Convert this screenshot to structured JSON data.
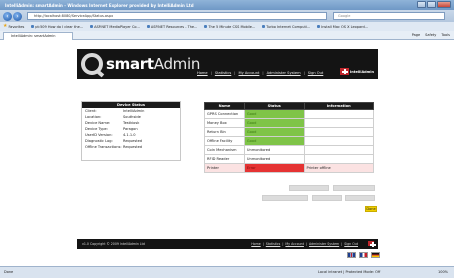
{
  "window": {
    "title": "IntelliAdmin: smartAdmin - Windows Internet Explorer provided by IntelliAdmin Ltd"
  },
  "browser": {
    "address": "http://localhost:8080/ServiceApp/Status.aspx",
    "search_placeholder": "Google",
    "favorites_label": "Favorites",
    "favorites": [
      "pt:509 How do I clear the...",
      "ASP.NET MediaPlayer Co...",
      "ASP.NET Resources - The...",
      "The 5 Minute CSS Mobile...",
      "Turbo Internet Computi...",
      "Install Mac OS X Leopard..."
    ],
    "tab_title": "IntelliAdmin: smartAdmin",
    "commands": [
      "Page",
      "Safety",
      "Tools"
    ]
  },
  "app": {
    "logo_prefix": "smart",
    "logo_suffix": "Admin",
    "nav": [
      "Home",
      "Statistics",
      "My Account",
      "Administer System",
      "Sign Out"
    ],
    "brand": "IntelliAdmin",
    "device_status": {
      "heading": "Device Status",
      "rows": [
        {
          "key": "Client:",
          "value": "IntelliAdmin"
        },
        {
          "key": "Location:",
          "value": "Southside"
        },
        {
          "key": "Device Name:",
          "value": "Testkiosk"
        },
        {
          "key": "Device Type:",
          "value": "Paragon"
        },
        {
          "key": "UserID Version:",
          "value": "4.1.1.0"
        },
        {
          "key": "Diagnostic Log:",
          "value": "Requested"
        },
        {
          "key": "Offline Transactions:",
          "value": "Requested"
        }
      ]
    },
    "status_table": {
      "headers": [
        "Name",
        "Status",
        "Information"
      ],
      "rows": [
        {
          "name": "GPRS Connection",
          "status": "Good",
          "info": "",
          "state": "good"
        },
        {
          "name": "Money Box",
          "status": "Good",
          "info": "",
          "state": "good"
        },
        {
          "name": "Return Bin",
          "status": "Good",
          "info": "",
          "state": "good"
        },
        {
          "name": "Offline Facility",
          "status": "Good",
          "info": "",
          "state": "good"
        },
        {
          "name": "Coin Mechanism",
          "status": "Unmonitored",
          "info": "",
          "state": "neutral"
        },
        {
          "name": "RFID Reader",
          "status": "Unmonitored",
          "info": "",
          "state": "neutral"
        },
        {
          "name": "Printer",
          "status": "Error",
          "info": "Printer offline",
          "state": "bad"
        }
      ]
    },
    "go_button": "Done",
    "footer": {
      "copyright": "v1.0 Copyright © 2009 IntelliAdmin Ltd",
      "nav": [
        "Home",
        "Statistics",
        "My Account",
        "Administer System",
        "Sign Out"
      ],
      "brand": "IntelliAdmin"
    },
    "languages": [
      "uk-flag",
      "fr-flag",
      "de-flag"
    ]
  },
  "statusbar": {
    "left": "Done",
    "zone": "Local intranet | Protected Mode: Off",
    "zoom": "100%"
  },
  "colors": {
    "good": "#7fc448",
    "error": "#e53333",
    "header": "#141414",
    "go": "#f2d000"
  }
}
